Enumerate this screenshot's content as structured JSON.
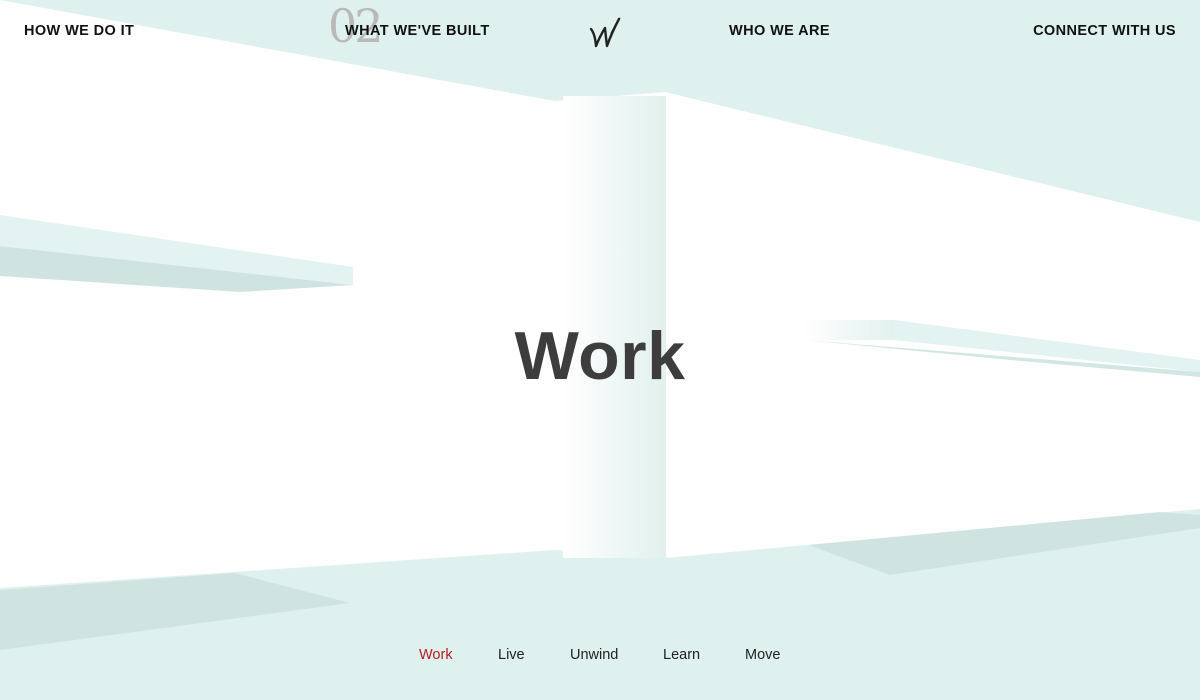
{
  "nav": {
    "how_we_do_it": "HOW WE DO IT",
    "what_weve_built": "WHAT WE'VE BUILT",
    "who_we_are": "WHO WE ARE",
    "connect_with_us": "CONNECT WITH US",
    "section_number": "02"
  },
  "logo": {
    "icon": "w-monogram-logo-icon"
  },
  "hero": {
    "title": "Work"
  },
  "subnav": {
    "items": [
      {
        "label": "Work",
        "active": true
      },
      {
        "label": "Live",
        "active": false
      },
      {
        "label": "Unwind",
        "active": false
      },
      {
        "label": "Learn",
        "active": false
      },
      {
        "label": "Move",
        "active": false
      }
    ]
  },
  "colors": {
    "background": "#ffffff",
    "mint_surface": "#dff1ef",
    "mint_shadow": "#cfe4e1",
    "title_text": "#3d3d3d",
    "nav_text": "#111111",
    "section_number": "#b9b9b9",
    "active_subnav": "#b3201f"
  }
}
